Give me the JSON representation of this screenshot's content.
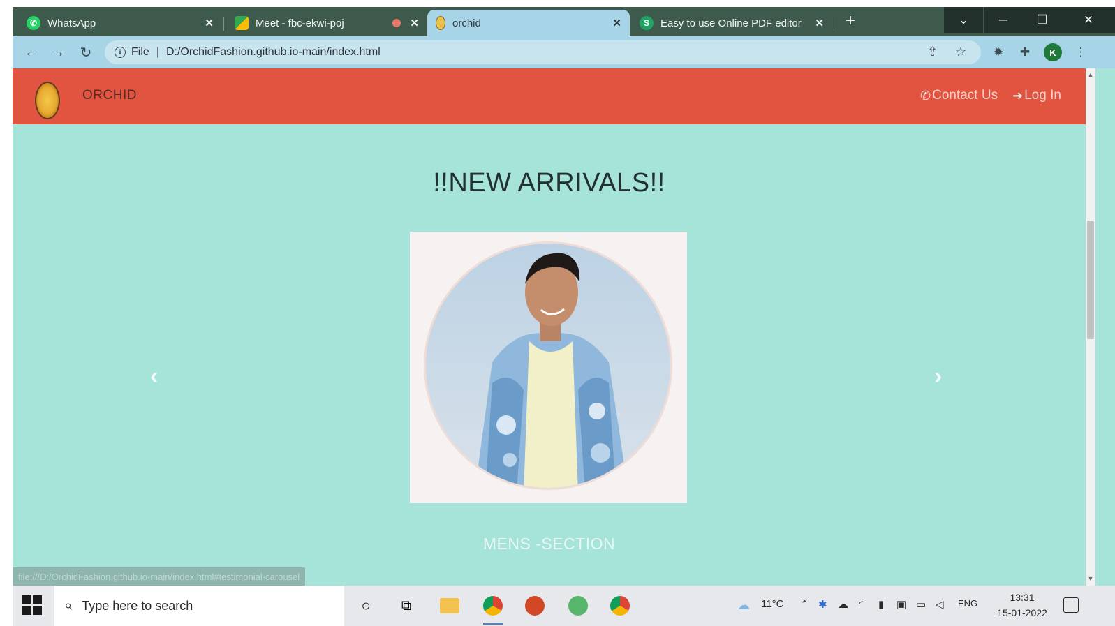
{
  "browser": {
    "tabs": [
      {
        "title": "WhatsApp",
        "icon": "whatsapp-icon"
      },
      {
        "title": "Meet - fbc-ekwi-poj",
        "icon": "meet-icon"
      },
      {
        "title": "orchid",
        "icon": "orchid-favicon",
        "active": true
      },
      {
        "title": "Easy to use Online PDF editor",
        "icon": "sejda-icon"
      }
    ],
    "address": {
      "scheme_label": "File",
      "url": "D:/OrchidFashion.github.io-main/index.html"
    },
    "profile_initial": "K",
    "status_url": "file:///D:/OrchidFashion.github.io-main/index.html#testimonial-carousel"
  },
  "site": {
    "brand": "ORCHID",
    "nav": {
      "contact": "Contact Us",
      "login": "Log In"
    },
    "heading": "!!NEW ARRIVALS!!",
    "section_label": "MENS -SECTION",
    "colors": {
      "navbar": "#e05440",
      "page": "#a6e3d9"
    }
  },
  "taskbar": {
    "search_placeholder": "Type here to search",
    "weather": "11°C",
    "language": "ENG",
    "time": "13:31",
    "date": "15-01-2022"
  }
}
